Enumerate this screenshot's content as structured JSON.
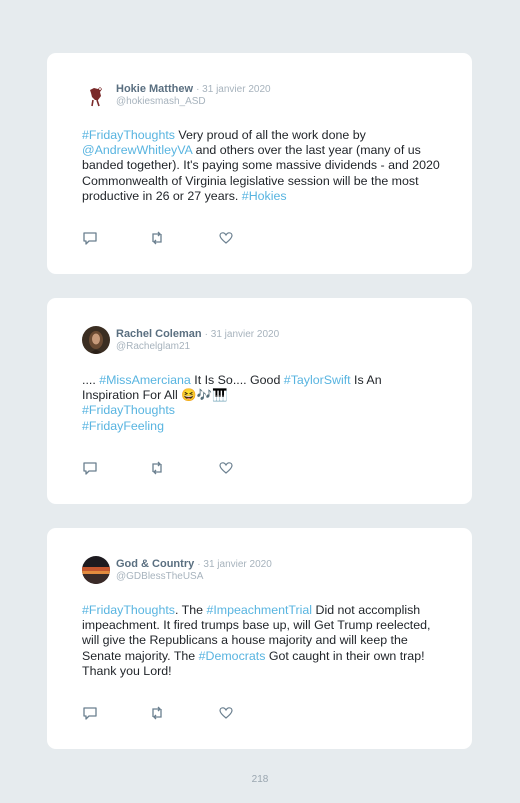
{
  "tweets": [
    {
      "name": "Hokie Matthew",
      "date": "· 31 janvier 2020",
      "handle": "@hokiesmash_ASD",
      "avatar_icon": "hokiebird-avatar",
      "text": [
        {
          "t": "#FridayThoughts",
          "tag": true
        },
        {
          "t": " Very proud of all the work done by ",
          "tag": false
        },
        {
          "t": "@AndrewWhitleyVA",
          "tag": true
        },
        {
          "t": " and others over the last year (many of us banded together). It's paying some massive dividends - and 2020 Commonwealth of Virginia legislative session will be the most productive in 26 or 27 years. ",
          "tag": false
        },
        {
          "t": "#Hokies",
          "tag": true
        }
      ]
    },
    {
      "name": "Rachel Coleman",
      "date": "· 31 janvier 2020",
      "handle": "@Rachelglam21",
      "avatar_icon": "portrait-avatar",
      "text": [
        {
          "t": ".... ",
          "tag": false
        },
        {
          "t": "#MissAmerciana",
          "tag": true
        },
        {
          "t": " It Is So.... Good ",
          "tag": false
        },
        {
          "t": "#TaylorSwift",
          "tag": true
        },
        {
          "t": " Is An Inspiration For All 😆🎶🎹",
          "tag": false
        },
        {
          "t": "\n",
          "tag": false
        },
        {
          "t": "#FridayThoughts",
          "tag": true
        },
        {
          "t": "\n",
          "tag": false
        },
        {
          "t": "#FridayFeeling",
          "tag": true
        }
      ]
    },
    {
      "name": "God & Country",
      "date": "· 31 janvier 2020",
      "handle": "@GDBlessTheUSA",
      "avatar_icon": "sunset-avatar",
      "text": [
        {
          "t": "#FridayThoughts",
          "tag": true
        },
        {
          "t": ". The ",
          "tag": false
        },
        {
          "t": "#ImpeachmentTrial",
          "tag": true
        },
        {
          "t": " Did not accomplish impeachment. It fired trumps base up, will Get Trump reelected, will give the Republicans a house majority and will keep the Senate majority. The ",
          "tag": false
        },
        {
          "t": "#Democrats",
          "tag": true
        },
        {
          "t": " Got caught in their own trap! Thank you Lord!",
          "tag": false
        }
      ]
    }
  ],
  "colors": {
    "hashtag": "#58b4e0",
    "name": "#5a6f80",
    "meta": "#a7b3bd",
    "background": "#e6ebee"
  },
  "page_number": "218"
}
